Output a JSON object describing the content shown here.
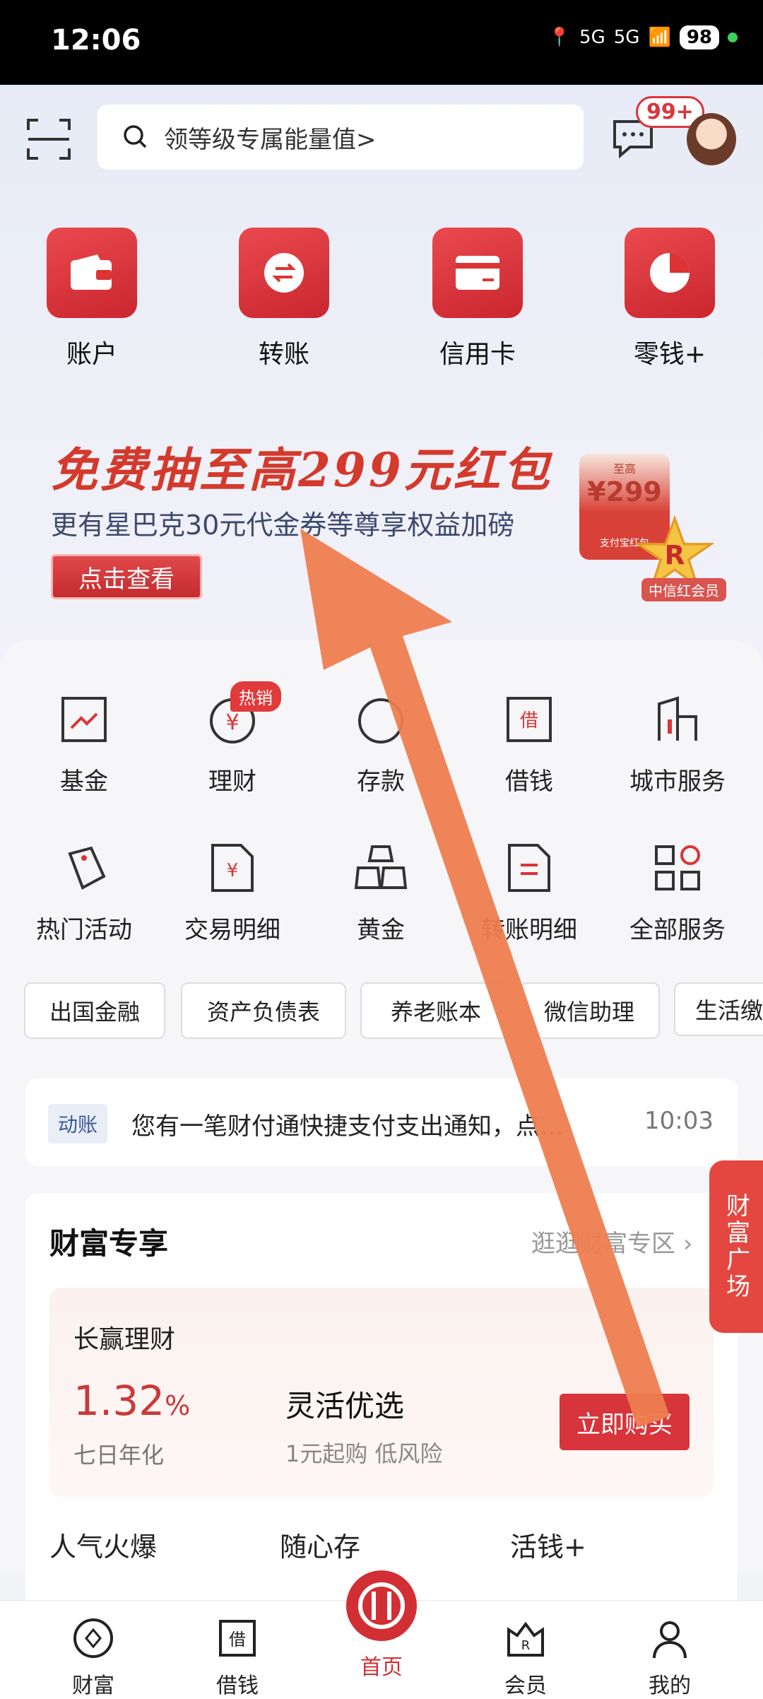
{
  "status": {
    "time": "12:06",
    "signal1": "5G",
    "signal2": "5G",
    "battery": "98"
  },
  "header": {
    "search_placeholder": "领等级专属能量值>",
    "message_badge": "99+"
  },
  "quick_actions": [
    {
      "label": "账户",
      "icon": "wallet-icon"
    },
    {
      "label": "转账",
      "icon": "transfer-icon"
    },
    {
      "label": "信用卡",
      "icon": "credit-card-icon"
    },
    {
      "label": "零钱+",
      "icon": "pie-chart-icon"
    }
  ],
  "banner": {
    "title_a": "免费抽至高",
    "title_b": "299",
    "title_c": "元红包",
    "subtitle": "更有星巴克30元代金券等尊享权益加磅",
    "button": "点击查看",
    "card_top": "至高",
    "card_amount": "¥299",
    "card_bottom": "支付宝红包",
    "member_label": "中信红会员"
  },
  "services": [
    {
      "label": "基金",
      "icon": "fund-icon"
    },
    {
      "label": "理财",
      "icon": "wealth-icon",
      "badge": "热销"
    },
    {
      "label": "存款",
      "icon": "deposit-icon"
    },
    {
      "label": "借钱",
      "icon": "loan-icon"
    },
    {
      "label": "城市服务",
      "icon": "city-icon"
    },
    {
      "label": "热门活动",
      "icon": "activity-icon"
    },
    {
      "label": "交易明细",
      "icon": "transaction-icon"
    },
    {
      "label": "黄金",
      "icon": "gold-icon"
    },
    {
      "label": "转账明细",
      "icon": "transfer-detail-icon"
    },
    {
      "label": "全部服务",
      "icon": "all-services-icon"
    }
  ],
  "chips": [
    "出国金融",
    "资产负债表",
    "养老账本",
    "微信助理",
    "生活缴"
  ],
  "notice": {
    "tag": "动账",
    "text": "您有一笔财付通快捷支付支出通知，点…",
    "time": "10:03"
  },
  "side_button": "财富广场",
  "wealth": {
    "title": "财富专享",
    "more": "逛逛财富专区",
    "product_category": "长赢理财",
    "rate": "1.32",
    "rate_unit": "%",
    "rate_label": "七日年化",
    "product_name": "灵活优选",
    "product_desc": "1元起购 低风险",
    "buy_button": "立即购买",
    "sub_tabs": [
      "人气火爆",
      "随心存",
      "活钱+"
    ]
  },
  "tabbar": [
    {
      "label": "财富",
      "icon": "wealth-tab-icon"
    },
    {
      "label": "借钱",
      "icon": "loan-tab-icon"
    },
    {
      "label": "首页",
      "icon": "home-logo-icon",
      "active": true
    },
    {
      "label": "会员",
      "icon": "member-tab-icon"
    },
    {
      "label": "我的",
      "icon": "profile-tab-icon"
    }
  ],
  "colors": {
    "brand_red": "#d22f35",
    "annotation_arrow": "#ee7d4f"
  }
}
